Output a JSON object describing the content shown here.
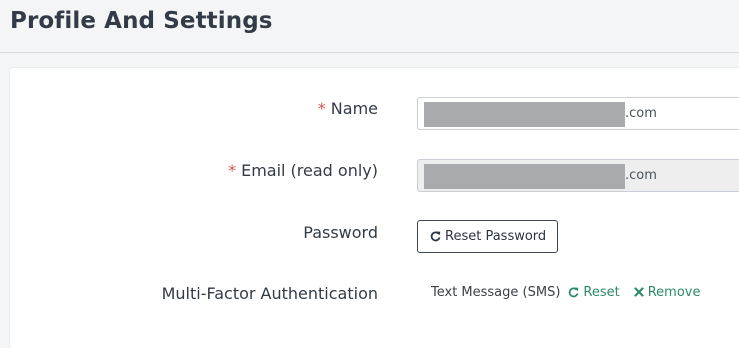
{
  "page": {
    "title": "Profile And Settings"
  },
  "form": {
    "required_marker": "*",
    "name": {
      "label": "Name",
      "value_suffix": ".com"
    },
    "email": {
      "label": "Email (read only)",
      "value_suffix": ".com"
    },
    "password": {
      "label": "Password",
      "reset_button_label": "Reset Password"
    },
    "mfa": {
      "label": "Multi-Factor Authentication",
      "method": "Text Message (SMS)",
      "reset_label": "Reset",
      "remove_label": "Remove"
    }
  },
  "icons": {
    "reset_password": "refresh-icon",
    "mfa_reset": "refresh-icon",
    "mfa_remove": "close-icon"
  },
  "colors": {
    "required": "#d9534f",
    "link": "#2e8b68",
    "redaction": "#a8aaad"
  }
}
